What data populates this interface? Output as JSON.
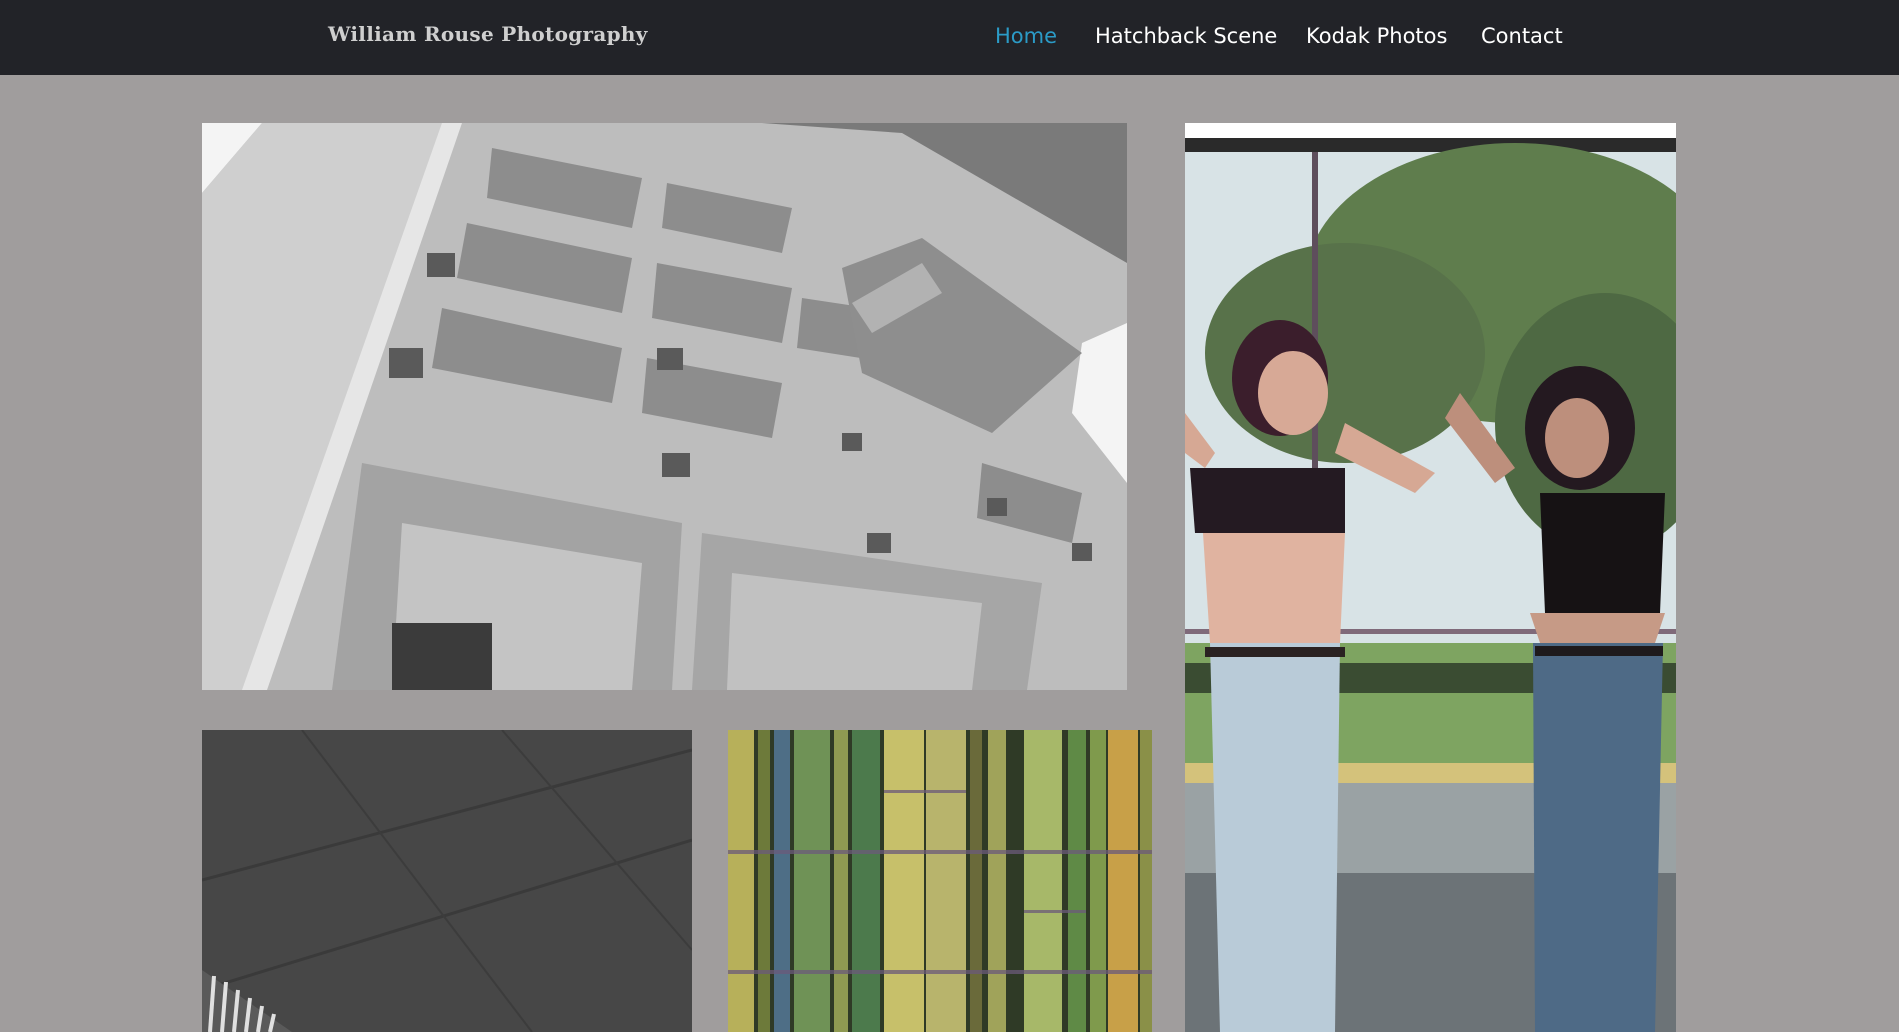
{
  "site": {
    "brand": "William Rouse Photography"
  },
  "nav": {
    "items": [
      {
        "label": "Home",
        "active": true
      },
      {
        "label": "Hatchback Scene",
        "active": false
      },
      {
        "label": "Kodak Photos",
        "active": false
      },
      {
        "label": "Contact",
        "active": false
      }
    ]
  },
  "colors": {
    "topbar": "#222328",
    "page_background": "#a09d9d",
    "nav_active": "#2b9bc7",
    "nav_text": "#ffffff",
    "brand_text": "#cfcfcf"
  },
  "gallery": {
    "photos": [
      {
        "name": "building-photo",
        "subject": "black and white brutalist building"
      },
      {
        "name": "mirror-portrait-photo",
        "subject": "woman reflected in mirror outdoors"
      },
      {
        "name": "ceiling-photo",
        "subject": "dark concrete ceiling"
      },
      {
        "name": "bamboo-photo",
        "subject": "bamboo stalks with carvings"
      }
    ]
  }
}
